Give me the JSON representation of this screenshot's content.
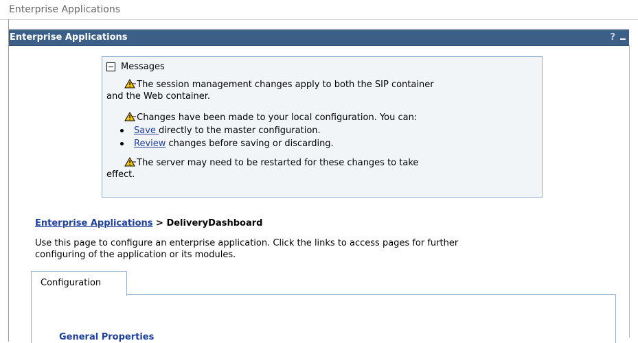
{
  "top_title": "Enterprise Applications",
  "portlet": {
    "title": "Enterprise Applications",
    "help_label": "?",
    "minimize_label": ""
  },
  "messages": {
    "header": "Messages",
    "items": [
      {
        "text_line1": "The session management changes apply to both the SIP container",
        "text_line2": "and the Web container."
      },
      {
        "text": "Changes have been made to your local configuration. You can:"
      },
      {
        "text_line1": "The server may need to be restarted for these changes to take",
        "text_line2": "effect."
      }
    ],
    "bullets": [
      {
        "link": "Save ",
        "rest": "directly to the master configuration."
      },
      {
        "link": "Review",
        "rest": " changes before saving or discarding."
      }
    ]
  },
  "breadcrumb": {
    "link": "Enterprise Applications",
    "separator": " > ",
    "current": "DeliveryDashboard"
  },
  "description": {
    "line1": "Use this page to configure an enterprise application. Click the links to access pages for further",
    "line2": "configuring of the application or its modules."
  },
  "tabs": [
    {
      "label": "Configuration"
    }
  ],
  "section_title": "General Properties",
  "colors": {
    "header_bg": "#3b5f87",
    "link": "#1f3f9f",
    "message_bg": "#f2f5f8",
    "warning": "#f3c400"
  },
  "icons": {
    "warning": "warning-icon",
    "collapse": "collapse-icon",
    "help": "help-icon",
    "minimize": "minimize-icon"
  }
}
